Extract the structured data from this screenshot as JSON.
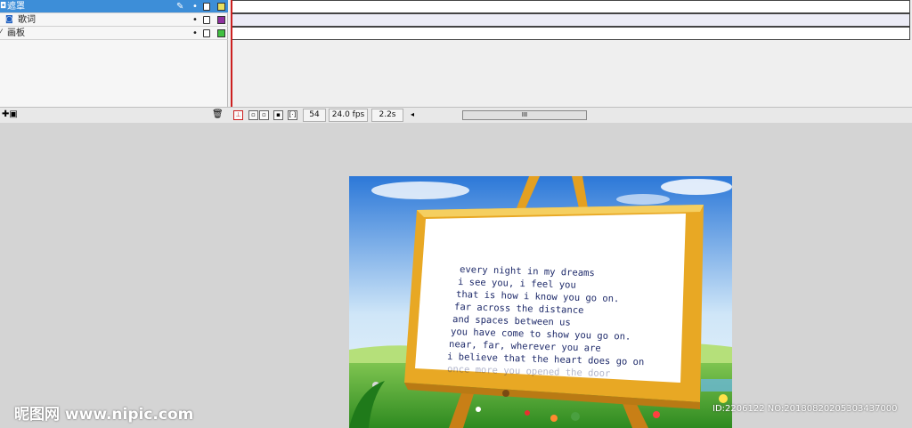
{
  "layers": [
    {
      "name": "遮罩",
      "selected": true,
      "color": "#e8e060"
    },
    {
      "name": "歌词",
      "selected": false,
      "color": "#9030a0"
    },
    {
      "name": "画板",
      "selected": false,
      "color": "#40c040"
    }
  ],
  "status": {
    "frame": "54",
    "fps": "24.0 fps",
    "time": "2.2s",
    "scroll_grip": "III"
  },
  "lyrics": [
    "every night in my dreams",
    "i see you, i feel you",
    "that is how i know you go on.",
    "far across the distance",
    "and spaces between us",
    "you have come to show you go on.",
    "near, far, wherever you are",
    "i believe that the heart does go on",
    "once more you opened the door"
  ],
  "watermark": {
    "left": "昵图网 www.nipic.com",
    "right": "ID:2206122 NO:20180820205303437000"
  },
  "colors": {
    "accent": "#3d8ed8",
    "playhead": "#cc2020"
  }
}
